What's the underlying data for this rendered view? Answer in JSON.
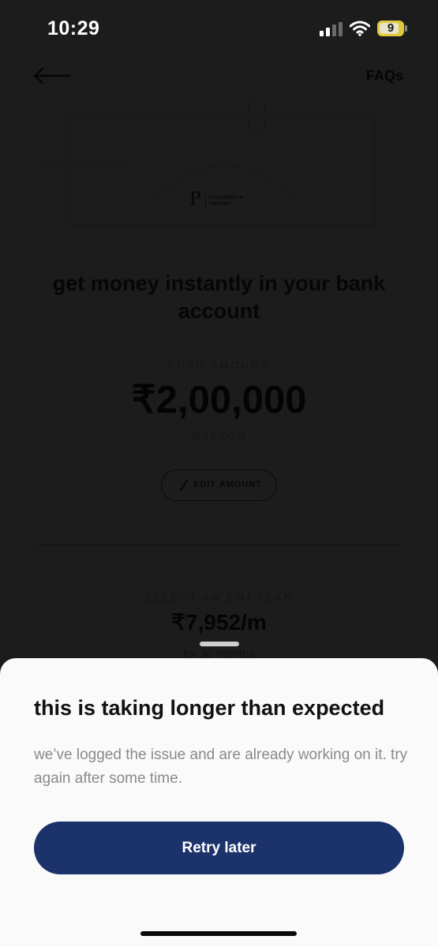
{
  "status_bar": {
    "time": "10:29",
    "battery_level": "9",
    "signal_icon": "signal-bars-icon",
    "wifi_icon": "wifi-icon",
    "battery_icon": "battery-icon"
  },
  "header": {
    "back_icon": "arrow-left-icon",
    "faqs_label": "FAQs"
  },
  "hero": {
    "logo_letter": "P",
    "logo_text_line1": "POONAWALLA",
    "logo_text_line2": "FINCORP"
  },
  "loan": {
    "headline": "get money instantly in your bank account",
    "amount_label": "LOAN AMOUNT",
    "amount": "₹2,00,000",
    "rate": "@25.00%",
    "edit_label": "EDIT AMOUNT"
  },
  "emi": {
    "label": "SELECT AN EMI PLAN",
    "value": "₹7,952/m",
    "duration": "for 36 months"
  },
  "sheet": {
    "title": "this is taking longer than expected",
    "message": "we’ve logged the issue and are already working on it. try again after some time.",
    "button_label": "Retry later"
  },
  "colors": {
    "overlay_bg": "#1c1c1c",
    "sheet_bg": "#fafafa",
    "primary_button": "#1c326b",
    "battery": "#e0c93a"
  }
}
